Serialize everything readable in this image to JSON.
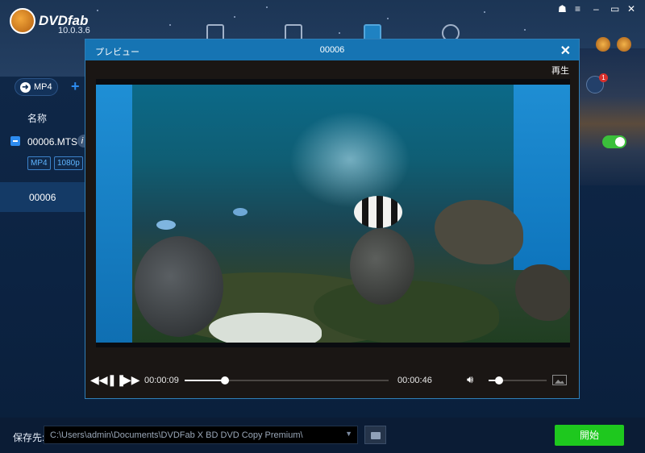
{
  "app": {
    "name": "DVDfab",
    "version": "10.0.3.6"
  },
  "toolbar": {
    "format_button": "MP4"
  },
  "file_list": {
    "column_name": "名称",
    "file": {
      "name": "00006.MTS",
      "info_icon": "i",
      "tags": [
        "MP4",
        "1080p"
      ]
    },
    "title_row": "00006"
  },
  "notification_count": "1",
  "preview": {
    "title": "プレビュー",
    "clip_name": "00006",
    "status": "再生",
    "current_time": "00:00:09",
    "total_time": "00:00:46",
    "progress": 0.196,
    "volume": 0.18
  },
  "bottom": {
    "save_label": "保存先:",
    "save_path": "C:\\Users\\admin\\Documents\\DVDFab X BD DVD Copy Premium\\",
    "start_button": "開始"
  },
  "icons": [
    "folder-icon",
    "close-icon",
    "rewind-icon",
    "pause-icon",
    "forward-icon",
    "volume-icon",
    "snapshot-icon",
    "list-icon"
  ]
}
